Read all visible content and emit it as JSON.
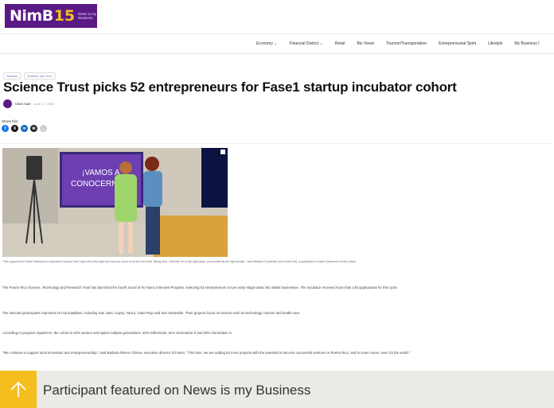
{
  "site": {
    "logo_text": "NimB",
    "logo_number": "15",
    "logo_tagline": "News is my Business"
  },
  "nav": {
    "items": [
      {
        "label": "Economy",
        "has_dropdown": true
      },
      {
        "label": "Financial District",
        "has_dropdown": true
      },
      {
        "label": "Retail",
        "has_dropdown": false
      },
      {
        "label": "Biz Views",
        "has_dropdown": false
      },
      {
        "label": "Tourism/Transportation",
        "has_dropdown": false
      },
      {
        "label": "Entrepreneurial Spirit",
        "has_dropdown": false
      },
      {
        "label": "Lifestyle",
        "has_dropdown": false
      },
      {
        "label": "My Business I",
        "has_dropdown": false
      }
    ]
  },
  "breadcrumbs": [
    "Noticias",
    "Science and Tech"
  ],
  "article": {
    "headline": "Science Trust picks 52 entrepreneurs for Fase1 startup incubator cohort",
    "author": "NIMB Staff",
    "date": "June 17, 2025",
    "share_label": "Share this:",
    "share_icons": [
      "facebook-icon",
      "x-icon",
      "linkedin-icon",
      "email-icon",
      "more-icon"
    ],
    "photo": {
      "screen_line1": "¡VAMOS A",
      "screen_line2": "CONOCERNO"
    },
    "caption": "\"The support from Fase1 Intensive is important to ensure that I start off on the right foot and can move on to the next level. Being here, I feel like I'm in the right place, surrounded by the right people,\" said Melissa Ful (center) from Dorit Dust, a participant in Fase1 Intensive's fourth cohort.",
    "paragraphs": [
      "The Puerto Rico Science, Technology and Research Trust has launched the fourth round of its Fase1 Intensive Program, selecting 52 entrepreneurs to turn early-stage ideas into viable businesses. The incubator received more than 145 applications for this cycle.",
      "The selected participants represent 22 municipalities, including San Juan, Cayey, Yauco, Cabo Rojo and San Sebastián. Their projects focus on sectors such as technology, tourism and health care.",
      "According to program organizers, the cohort is 62% women and spans multiple generations: 40% millennials, 31% Generation Z and 29% Generation X.",
      "\"We continue to support local innovation and entrepreneurship,\" said Barbara Rivera Chinea, executive director of Fase1. \"This time, we are adding 52 more projects with the potential to become successful ventures in Puerto Rico, and in some cases, even for the world.\""
    ]
  },
  "banner": {
    "text": "Participant featured on News is my Business"
  },
  "colors": {
    "brand_purple": "#5a1a86",
    "banner_yellow": "#f5be1c",
    "banner_bg": "#eceae7"
  }
}
